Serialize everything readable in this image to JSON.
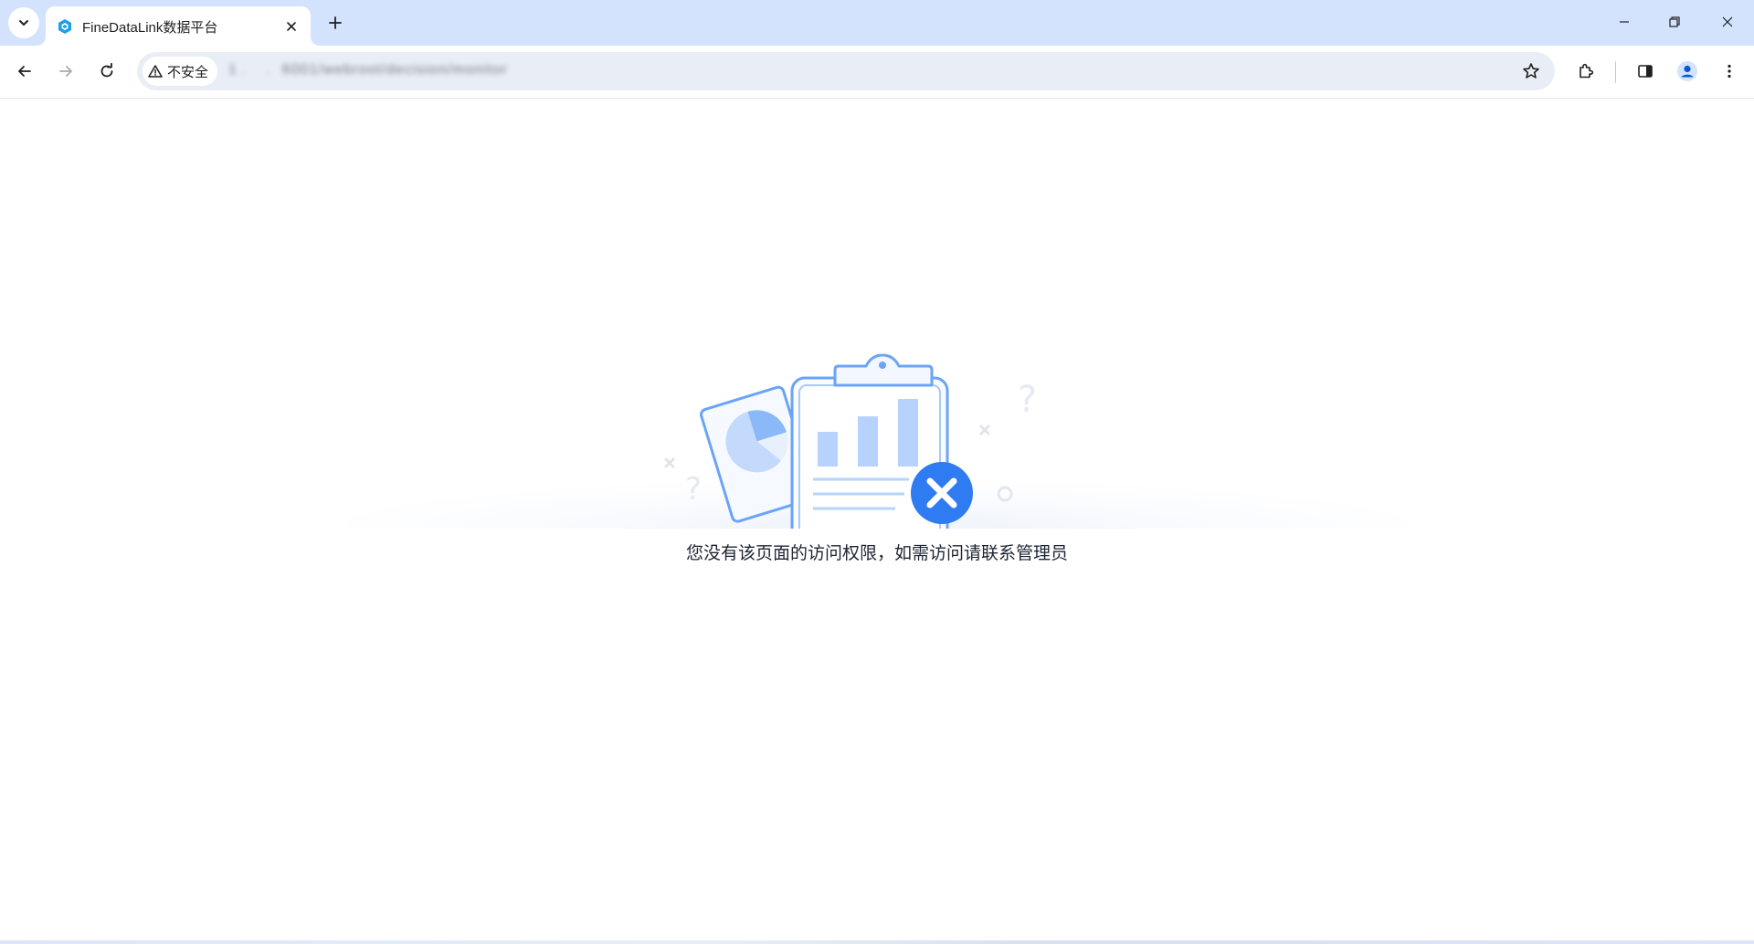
{
  "browser": {
    "tab": {
      "title": "FineDataLink数据平台",
      "favicon": "finedatalink-logo-icon"
    },
    "toolbar": {
      "security_label": "不安全",
      "url": "1 .     .   6001/webroot/decision/monitor"
    },
    "colors": {
      "tab_strip": "#d3e3fd",
      "omnibox": "#e9eef6",
      "accent_blue": "#2f7bf1",
      "illustration_light": "#c3dafc",
      "illustration_stroke": "#6aa4f8"
    }
  },
  "page": {
    "message": "您没有该页面的访问权限，如需访问请联系管理员"
  }
}
